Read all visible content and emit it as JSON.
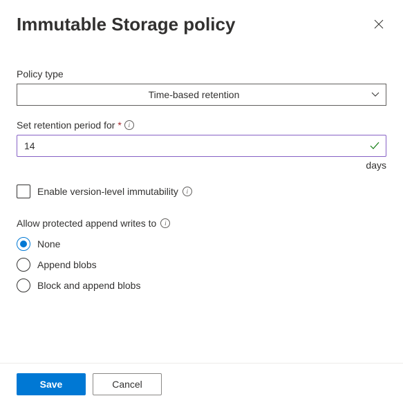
{
  "header": {
    "title": "Immutable Storage policy"
  },
  "policyType": {
    "label": "Policy type",
    "value": "Time-based retention"
  },
  "retention": {
    "label": "Set retention period for",
    "value": "14",
    "unit": "days"
  },
  "versionLevel": {
    "label": "Enable version-level immutability",
    "checked": false
  },
  "appendWrites": {
    "label": "Allow protected append writes to",
    "options": [
      {
        "label": "None",
        "checked": true
      },
      {
        "label": "Append blobs",
        "checked": false
      },
      {
        "label": "Block and append blobs",
        "checked": false
      }
    ]
  },
  "footer": {
    "save": "Save",
    "cancel": "Cancel"
  }
}
